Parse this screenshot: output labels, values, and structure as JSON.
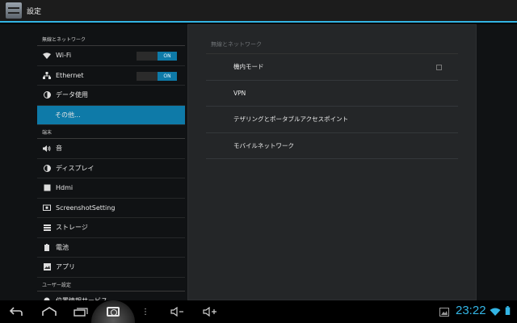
{
  "app": {
    "title": "設定"
  },
  "headers": [
    {
      "type": "category",
      "label": "無線とネットワーク"
    },
    {
      "type": "item",
      "label": "Wi-Fi",
      "icon": "wifi-icon",
      "toggle": "ON"
    },
    {
      "type": "item",
      "label": "Ethernet",
      "icon": "ethernet-icon",
      "toggle": "ON"
    },
    {
      "type": "item",
      "label": "データ使用",
      "icon": "data-usage-icon"
    },
    {
      "type": "item",
      "label": "その他...",
      "selected": true
    },
    {
      "type": "category",
      "label": "端末"
    },
    {
      "type": "item",
      "label": "音",
      "icon": "sound-icon"
    },
    {
      "type": "item",
      "label": "ディスプレイ",
      "icon": "display-icon"
    },
    {
      "type": "item",
      "label": "Hdmi",
      "icon": "hdmi-icon"
    },
    {
      "type": "item",
      "label": "ScreenshotSetting",
      "icon": "screenshot-icon"
    },
    {
      "type": "item",
      "label": "ストレージ",
      "icon": "storage-icon"
    },
    {
      "type": "item",
      "label": "電池",
      "icon": "battery-icon"
    },
    {
      "type": "item",
      "label": "アプリ",
      "icon": "apps-icon"
    },
    {
      "type": "category",
      "label": "ユーザー設定"
    },
    {
      "type": "item",
      "label": "位置情報サービス",
      "icon": "location-icon"
    }
  ],
  "detail": {
    "header": "無線とネットワーク",
    "items": [
      {
        "label": "機内モード",
        "checkbox": false
      },
      {
        "label": "VPN"
      },
      {
        "label": "テザリングとポータブルアクセスポイント"
      },
      {
        "label": "モバイルネットワーク"
      }
    ]
  },
  "status": {
    "clock": "23:22",
    "accent": "#33b5e5"
  },
  "navbar": {
    "buttons": [
      "back-icon",
      "home-icon",
      "recent-apps-icon",
      "screenshot-icon",
      "menu-icon",
      "volume-down-icon",
      "volume-up-icon"
    ]
  }
}
